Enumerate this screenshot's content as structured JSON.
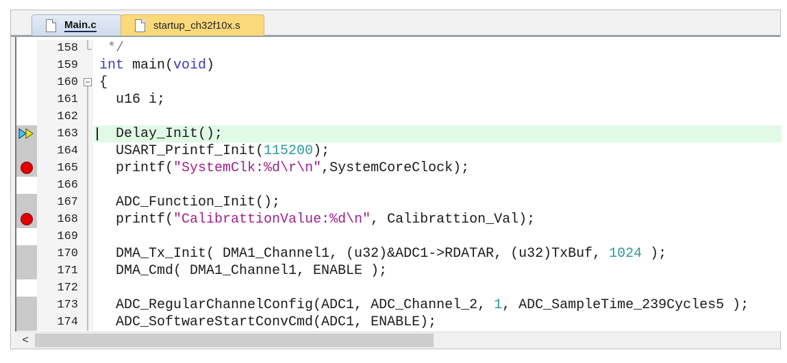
{
  "tabs": [
    {
      "label": "Main.c",
      "active": true
    },
    {
      "label": "startup_ch32f10x.s",
      "active": false
    }
  ],
  "colors": {
    "keyword": "#3a3ab8",
    "string": "#a0208a",
    "number": "#2a9a9a",
    "comment": "#808080",
    "current_line": "#e1fae6",
    "breakpoint": "#e00000"
  },
  "lines": [
    {
      "num": "158",
      "fold": "end",
      "tokens": [
        {
          "t": " */",
          "c": "comment"
        }
      ]
    },
    {
      "num": "159",
      "tokens": [
        {
          "t": "int",
          "c": "keyword"
        },
        {
          "t": " main("
        },
        {
          "t": "void",
          "c": "keyword"
        },
        {
          "t": ")"
        }
      ]
    },
    {
      "num": "160",
      "fold": "start",
      "tokens": [
        {
          "t": "{"
        }
      ]
    },
    {
      "num": "161",
      "fold": "line",
      "tokens": [
        {
          "t": "  u16 i;"
        }
      ]
    },
    {
      "num": "162",
      "fold": "line",
      "tokens": []
    },
    {
      "num": "163",
      "fold": "line",
      "gutter": "exec",
      "current": true,
      "tokens": [
        {
          "t": "  Delay_Init();"
        }
      ]
    },
    {
      "num": "164",
      "fold": "line",
      "gutter": "code",
      "tokens": [
        {
          "t": "  USART_Printf_Init("
        },
        {
          "t": "115200",
          "c": "number"
        },
        {
          "t": ");"
        }
      ]
    },
    {
      "num": "165",
      "fold": "line",
      "gutter": "bp",
      "tokens": [
        {
          "t": "  printf("
        },
        {
          "t": "\"SystemClk:%d\\r\\n\"",
          "c": "string"
        },
        {
          "t": ",SystemCoreClock);"
        }
      ]
    },
    {
      "num": "166",
      "fold": "line",
      "tokens": []
    },
    {
      "num": "167",
      "fold": "line",
      "gutter": "code",
      "tokens": [
        {
          "t": "  ADC_Function_Init();"
        }
      ]
    },
    {
      "num": "168",
      "fold": "line",
      "gutter": "bp",
      "tokens": [
        {
          "t": "  printf("
        },
        {
          "t": "\"CalibrattionValue:%d\\n\"",
          "c": "string"
        },
        {
          "t": ", Calibrattion_Val);"
        }
      ]
    },
    {
      "num": "169",
      "fold": "line",
      "tokens": []
    },
    {
      "num": "170",
      "fold": "line",
      "gutter": "code",
      "tokens": [
        {
          "t": "  DMA_Tx_Init( DMA1_Channel1, (u32)&ADC1->RDATAR, (u32)TxBuf, "
        },
        {
          "t": "1024",
          "c": "number"
        },
        {
          "t": " );"
        }
      ]
    },
    {
      "num": "171",
      "fold": "line",
      "gutter": "code",
      "tokens": [
        {
          "t": "  DMA_Cmd( DMA1_Channel1, ENABLE );"
        }
      ]
    },
    {
      "num": "172",
      "fold": "line",
      "tokens": []
    },
    {
      "num": "173",
      "fold": "line",
      "gutter": "code",
      "tokens": [
        {
          "t": "  ADC_RegularChannelConfig(ADC1, ADC_Channel_2, "
        },
        {
          "t": "1",
          "c": "number"
        },
        {
          "t": ", ADC_SampleTime_239Cycles5 );"
        }
      ]
    },
    {
      "num": "174",
      "fold": "line",
      "gutter": "code",
      "tokens": [
        {
          "t": "  ADC_SoftwareStartConvCmd(ADC1, ENABLE);"
        }
      ]
    }
  ],
  "scrollbar": {
    "left_arrow": "<",
    "horizontal_position": 0.0
  }
}
